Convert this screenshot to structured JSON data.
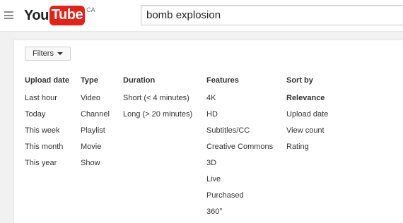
{
  "header": {
    "logo_you": "You",
    "logo_tube": "Tube",
    "logo_region": "CA",
    "search_value": "bomb explosion"
  },
  "filters_button": {
    "label": "Filters"
  },
  "filter_columns": {
    "upload_date": {
      "heading": "Upload date",
      "options": [
        "Last hour",
        "Today",
        "This week",
        "This month",
        "This year"
      ]
    },
    "type": {
      "heading": "Type",
      "options": [
        "Video",
        "Channel",
        "Playlist",
        "Movie",
        "Show"
      ]
    },
    "duration": {
      "heading": "Duration",
      "options": [
        "Short (< 4 minutes)",
        "Long (> 20 minutes)"
      ]
    },
    "features": {
      "heading": "Features",
      "options": [
        "4K",
        "HD",
        "Subtitles/CC",
        "Creative Commons",
        "3D",
        "Live",
        "Purchased",
        "360°"
      ]
    },
    "sort_by": {
      "heading": "Sort by",
      "options": [
        "Relevance",
        "Upload date",
        "View count",
        "Rating"
      ],
      "selected": "Relevance"
    }
  },
  "colors": {
    "brand_red": "#e62117",
    "text": "#333333",
    "background": "#f1f1f1"
  }
}
